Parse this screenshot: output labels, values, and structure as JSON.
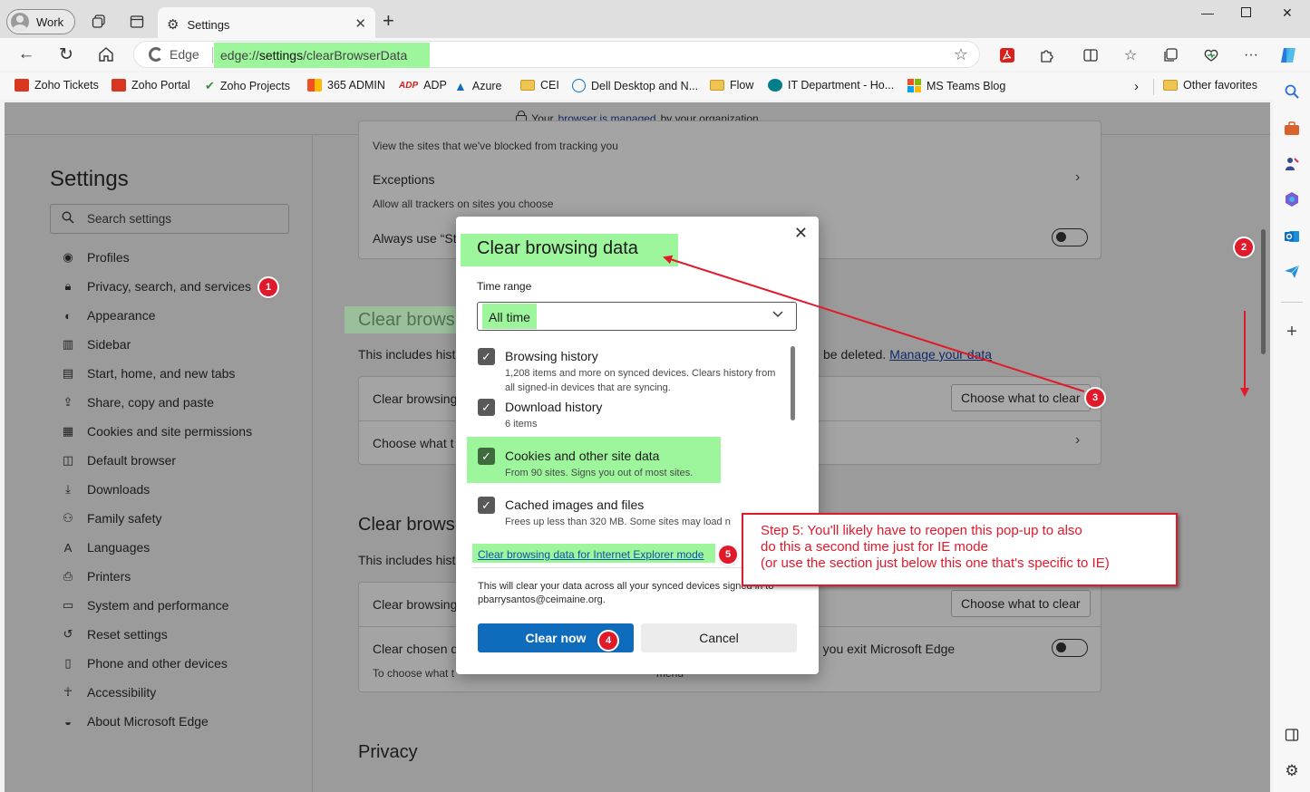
{
  "browser": {
    "profile_label": "Work",
    "tab_title": "Settings",
    "edge_label": "Edge",
    "url_prefix": "edge://",
    "url_path": "settings",
    "url_rest": "/clearBrowserData"
  },
  "favorites": [
    {
      "label": "Zoho Tickets",
      "icon": "cei-icon"
    },
    {
      "label": "Zoho Portal",
      "icon": "cei-icon"
    },
    {
      "label": "Zoho Projects",
      "icon": "check-icon"
    },
    {
      "label": "365 ADMIN",
      "icon": "office-icon"
    },
    {
      "label": "ADP",
      "icon": "adp-icon"
    },
    {
      "label": "Azure",
      "icon": "azure-icon"
    },
    {
      "label": "CEI",
      "icon": "folder-icon"
    },
    {
      "label": "Dell Desktop and N...",
      "icon": "dell-icon"
    },
    {
      "label": "Flow",
      "icon": "folder-icon"
    },
    {
      "label": "IT Department - Ho...",
      "icon": "sharepoint-icon"
    },
    {
      "label": "MS Teams Blog",
      "icon": "microsoft-icon"
    }
  ],
  "other_favorites": "Other favorites",
  "managed_banner": {
    "prefix": "Your",
    "link": "browser is managed",
    "suffix": "by your organization"
  },
  "settings_nav": {
    "title": "Settings",
    "search_placeholder": "Search settings",
    "items": [
      "Profiles",
      "Privacy, search, and services",
      "Appearance",
      "Sidebar",
      "Start, home, and new tabs",
      "Share, copy and paste",
      "Cookies and site permissions",
      "Default browser",
      "Downloads",
      "Family safety",
      "Languages",
      "Printers",
      "System and performance",
      "Reset settings",
      "Phone and other devices",
      "Accessibility",
      "About Microsoft Edge"
    ]
  },
  "content": {
    "blocked_sub": "View the sites that we've blocked from tracking you",
    "exceptions": "Exceptions",
    "exceptions_sub": "Allow all trackers on sites you choose",
    "always_use": "Always use “St",
    "clear_heading_1": "Clear browsi",
    "includes_1": "This includes histo",
    "will_be_deleted": "be deleted.",
    "manage_data": "Manage your data",
    "clear_browsing_row": "Clear browsing",
    "choose_btn": "Choose what to clear",
    "choose_what_row": "Choose what t",
    "clear_heading_2": "Clear brows",
    "includes_2": "This includes histo",
    "clear_browsing_row_2": "Clear browsing",
    "choose_btn_2": "Choose what to clear",
    "clear_chosen": "Clear chosen d",
    "exit_edge": "e you exit Microsoft Edge",
    "to_choose": "To choose what t",
    "clear_menu": "menu",
    "privacy_heading": "Privacy"
  },
  "dialog": {
    "title": "Clear browsing data",
    "time_range_label": "Time range",
    "time_range_value": "All time",
    "options": [
      {
        "title": "Browsing history",
        "desc": "1,208 items and more on synced devices. Clears history from all signed-in devices that are syncing.",
        "checked": true
      },
      {
        "title": "Download history",
        "desc": "6 items",
        "checked": true
      },
      {
        "title": "Cookies and other site data",
        "desc": "From 90 sites. Signs you out of most sites.",
        "checked": true
      },
      {
        "title": "Cached images and files",
        "desc": "Frees up less than 320 MB. Some sites may load n",
        "checked": true
      }
    ],
    "ie_link": "Clear browsing data for Internet Explorer mode",
    "sync_note": "This will clear your data across all your synced devices signed in to pbarrysantos@ceimaine.org.",
    "clear_now": "Clear now",
    "cancel": "Cancel"
  },
  "annotations": {
    "badges": [
      "1",
      "2",
      "3",
      "4",
      "5"
    ],
    "callout_lines": [
      "Step 5: You'll likely have to reopen this pop-up to also",
      "do this a second time just for IE mode",
      "(or use the section just below this one that's specific to IE)"
    ],
    "accent": "#e0192b",
    "highlight": "#9df59c"
  }
}
